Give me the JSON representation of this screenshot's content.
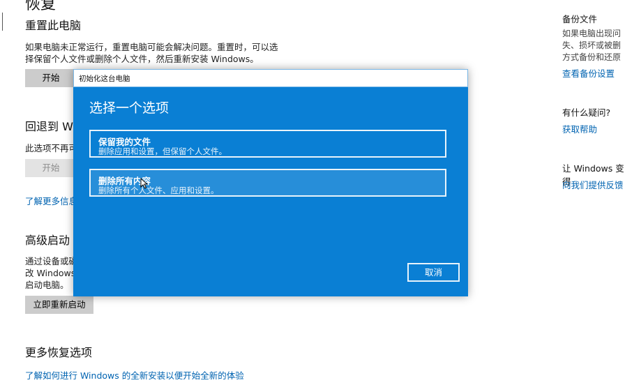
{
  "page": {
    "title": "恢复"
  },
  "reset": {
    "heading": "重置此电脑",
    "desc_line1": "如果电脑未正常运行，重置电脑可能会解决问题。重置时，可以选",
    "desc_line2": "择保留个人文件或删除个人文件，然后重新安装 Windows。",
    "start_button": "开始"
  },
  "rollback": {
    "heading_partial": "回退到 W",
    "desc_partial": "此选项不再可",
    "start_button": "开始",
    "learn_more_partial": "了解更多信息"
  },
  "advanced": {
    "heading_partial": "高级启动",
    "line1_partial": "通过设备或磁",
    "line2_partial": "改 Windows",
    "line3": "启动电脑。",
    "restart_button": "立即重新启动"
  },
  "more": {
    "heading": "更多恢复选项",
    "link": "了解如何进行 Windows 的全新安装以便开始全新的体验"
  },
  "sidebar": {
    "backup_heading": "备份文件",
    "backup_line1": "如果电脑出现问",
    "backup_line2": "失、损坏或被删",
    "backup_line3": "方式备份和还原",
    "backup_link": "查看备份设置",
    "question_heading": "有什么疑问?",
    "help_link": "获取帮助",
    "improve_heading": "让 Windows 变得",
    "feedback_link": "向我们提供反馈"
  },
  "dialog": {
    "window_title": "初始化这台电脑",
    "heading": "选择一个选项",
    "options": [
      {
        "title": "保留我的文件",
        "desc": "删除应用和设置，但保留个人文件。"
      },
      {
        "title": "删除所有内容",
        "desc": "删除所有个人文件、应用和设置。"
      }
    ],
    "cancel_button": "取消"
  },
  "colors": {
    "dialog_bg": "#0a7fd4",
    "link": "#0063b1",
    "button_bg": "#cccccc"
  }
}
